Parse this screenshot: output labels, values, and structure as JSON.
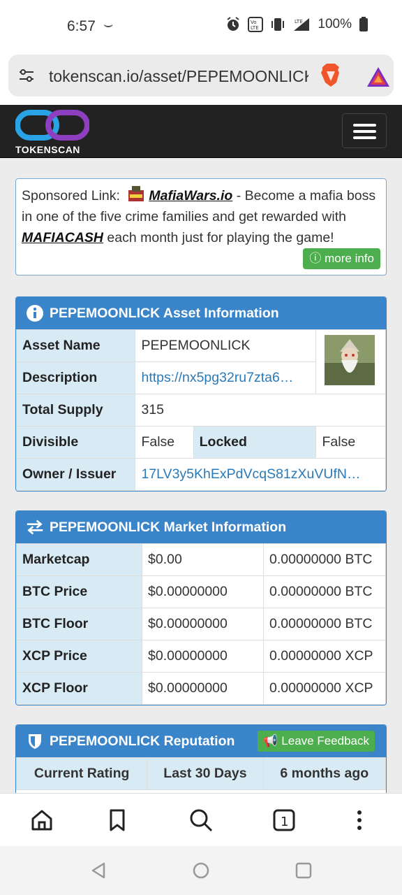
{
  "status_bar": {
    "time": "6:57",
    "battery": "100%",
    "icons": [
      "alarm-icon",
      "volte-icon",
      "vibrate-icon",
      "lte-signal-icon",
      "battery-icon"
    ]
  },
  "browser": {
    "url": "tokenscan.io/asset/PEPEMOONLICK"
  },
  "site": {
    "brand": "TOKENSCAN"
  },
  "sponsor": {
    "prefix": "Sponsored Link:",
    "game_link": "MafiaWars.io",
    "text1": " - Become a mafia boss in one of the five crime families and get rewarded with ",
    "token": "MAFIACASH",
    "text2": " each month just for playing the game!",
    "more_info": "more info"
  },
  "asset_info": {
    "title": "PEPEMOONLICK Asset Information",
    "rows": {
      "asset_name_label": "Asset Name",
      "asset_name": "PEPEMOONLICK",
      "description_label": "Description",
      "description": "https://nx5pg32ru7zta6…",
      "total_supply_label": "Total Supply",
      "total_supply": "315",
      "divisible_label": "Divisible",
      "divisible": "False",
      "locked_label": "Locked",
      "locked": "False",
      "owner_label": "Owner / Issuer",
      "owner": "17LV3y5KhExPdVcqS81zXuVUfN…"
    }
  },
  "market_info": {
    "title": "PEPEMOONLICK Market Information",
    "rows": [
      {
        "label": "Marketcap",
        "usd": "$0.00",
        "native": "0.00000000 BTC"
      },
      {
        "label": "BTC Price",
        "usd": "$0.00000000",
        "native": "0.00000000 BTC"
      },
      {
        "label": "BTC Floor",
        "usd": "$0.00000000",
        "native": "0.00000000 BTC"
      },
      {
        "label": "XCP Price",
        "usd": "$0.00000000",
        "native": "0.00000000 XCP"
      },
      {
        "label": "XCP Floor",
        "usd": "$0.00000000",
        "native": "0.00000000 XCP"
      }
    ]
  },
  "reputation": {
    "title": "PEPEMOONLICK Reputation",
    "feedback_button": "Leave Feedback",
    "columns": [
      "Current Rating",
      "Last 30 Days",
      "6 months ago"
    ]
  },
  "colors": {
    "panel_header": "#3a84c9",
    "label_bg": "#d8ebf5",
    "green_button": "#4cae4c",
    "nav_bg": "#222222"
  }
}
